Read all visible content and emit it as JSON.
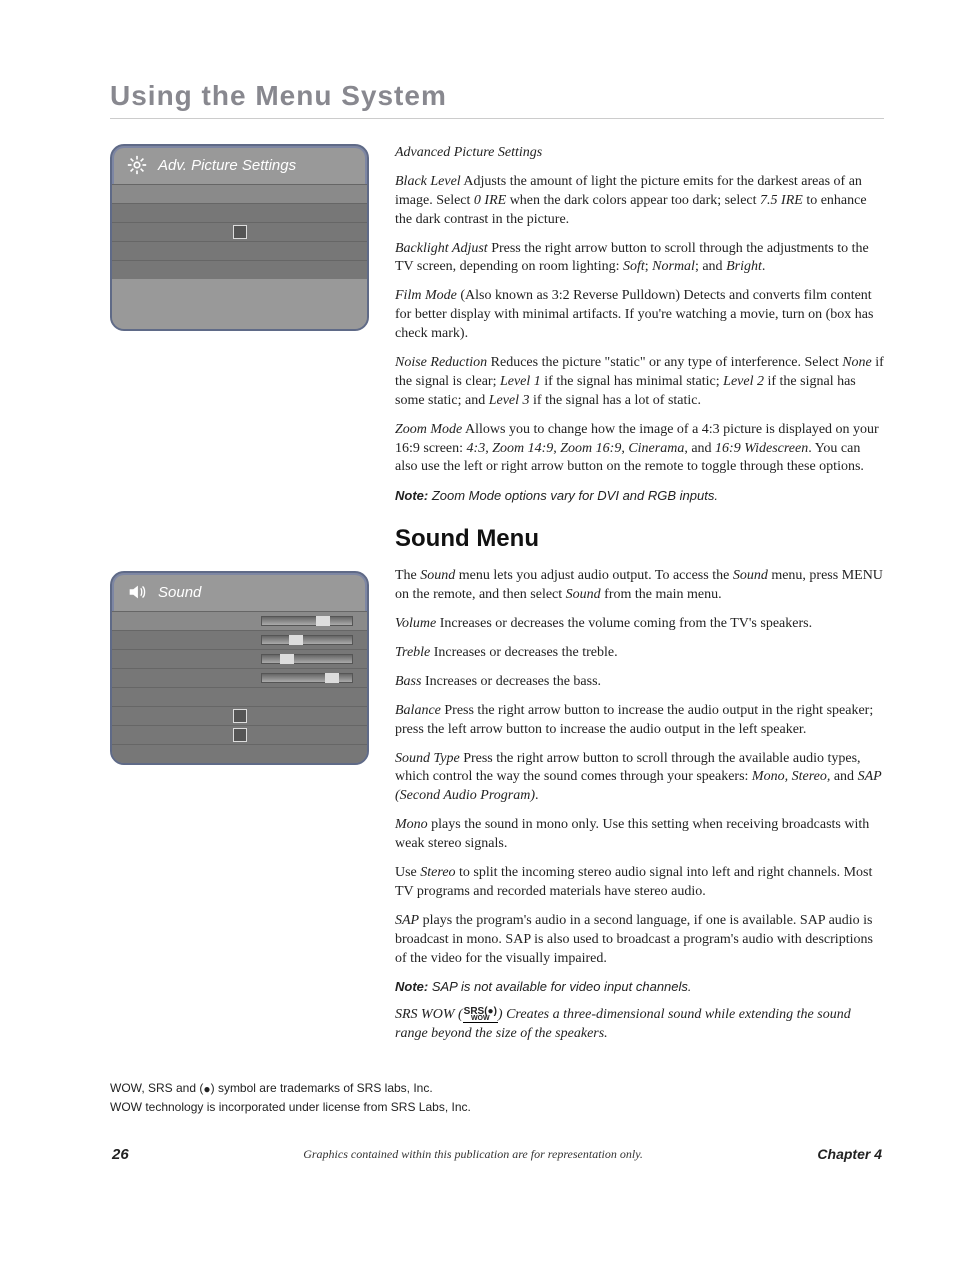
{
  "page": {
    "title": "Using the Menu System",
    "number": "26",
    "footer_center": "Graphics contained within this publication are for representation only.",
    "chapter": "Chapter 4"
  },
  "osd1": {
    "title": "Adv. Picture Settings"
  },
  "osd2": {
    "title": "Sound"
  },
  "adv": {
    "heading": "Advanced Picture Settings",
    "black_level_term": "Black Level",
    "black_level_text1": "   Adjusts the amount of light the picture emits for the darkest areas of an image. Select ",
    "black_level_ire0": "0 IRE",
    "black_level_text2": " when the dark colors appear too dark; select ",
    "black_level_ire75": "7.5 IRE",
    "black_level_text3": " to enhance the dark contrast in the picture.",
    "backlight_term": "Backlight Adjust",
    "backlight_text1": "   Press the right arrow button to scroll through the adjustments to the TV screen, depending on room lighting: ",
    "backlight_soft": "Soft",
    "backlight_sep1": "; ",
    "backlight_normal": "Normal",
    "backlight_sep2": "; and ",
    "backlight_bright": "Bright",
    "backlight_end": ".",
    "film_term": "Film Mode",
    "film_text": " (Also known as 3:2 Reverse Pulldown)   Detects and converts film content for better display with minimal artifacts. If you're watching a movie, turn on (box has check mark).",
    "noise_term": "Noise Reduction",
    "noise_text1": "    Reduces the picture \"static\" or any type of interference. Select ",
    "noise_none": "None",
    "noise_text2": " if the signal is clear; ",
    "noise_l1": "Level 1",
    "noise_text3": " if the signal has minimal static; ",
    "noise_l2": "Level 2",
    "noise_text4": " if the signal has some static; and ",
    "noise_l3": "Level 3",
    "noise_text5": " if the signal has a lot of static.",
    "zoom_term": "Zoom Mode",
    "zoom_text1": "   Allows you to change how the image of a 4:3 picture is displayed on your 16:9 screen: ",
    "zoom_43": "4:3",
    "zoom_sep": ", ",
    "zoom_149": "Zoom 14:9",
    "zoom_169": "Zoom 16:9",
    "zoom_cin": "Cinerama",
    "zoom_and": ", and ",
    "zoom_ws": "16:9 Widescreen",
    "zoom_text2": ". You can also use the left or right arrow button on the remote to toggle through these options.",
    "note_label": "Note:",
    "note_text": " Zoom Mode options vary for DVI and RGB inputs."
  },
  "sound": {
    "heading": "Sound Menu",
    "intro1": "The ",
    "intro_sound1": "Sound",
    "intro2": " menu lets you adjust audio output. To access the ",
    "intro_sound2": "Sound",
    "intro3": " menu, press MENU on the remote, and then select ",
    "intro_sound3": "Sound",
    "intro4": " from the main menu.",
    "volume_term": "Volume",
    "volume_text": "   Increases or decreases the volume coming from the TV's speakers.",
    "treble_term": "Treble",
    "treble_text": "  Increases or decreases the treble.",
    "bass_term": "Bass",
    "bass_text": "  Increases or decreases the bass.",
    "balance_term": "Balance",
    "balance_text": "  Press the right arrow button to increase the audio output in the right speaker; press the left arrow button to increase the audio output in the left speaker.",
    "soundtype_term": "Sound Type",
    "soundtype_text1": "   Press the right arrow button to scroll through the available audio types, which control the way the sound comes through your speakers: ",
    "soundtype_opts": "Mono, Stereo,",
    "soundtype_and": " and ",
    "soundtype_sap": "SAP (Second Audio Program)",
    "soundtype_end": ".",
    "mono_term": "Mono",
    "mono_text": " plays the sound in mono only. Use this setting when receiving broadcasts with weak stereo signals.",
    "stereo_pre": "Use ",
    "stereo_term": "Stereo",
    "stereo_text": " to split the incoming stereo audio signal into left and right channels. Most TV programs and recorded materials have stereo audio.",
    "sap_term": "SAP",
    "sap_text": " plays the program's audio in a second language, if one is available. SAP audio is broadcast in mono. SAP is also used to broadcast a program's audio with descriptions of the video for the visually impaired.",
    "note_label": "Note:",
    "note_text": " SAP is not available for video input channels.",
    "srs_term": "SRS WOW (",
    "srs_text": ")   Creates a three-dimensional sound while extending the sound range beyond the size of the speakers."
  },
  "trademark": {
    "line1a": "WOW, SRS and (",
    "line1b": ") symbol are trademarks of SRS labs, Inc.",
    "line2": "WOW technology is incorporated under license from SRS Labs, Inc."
  }
}
